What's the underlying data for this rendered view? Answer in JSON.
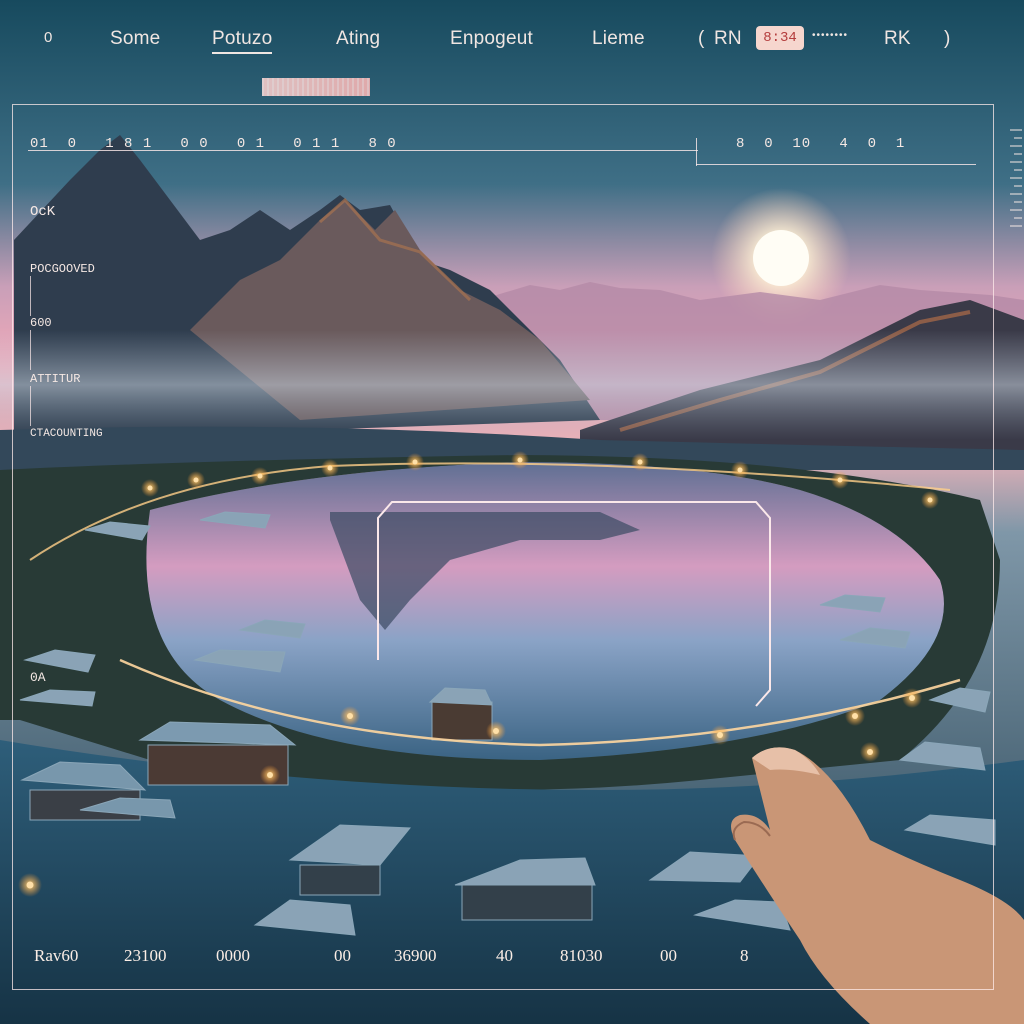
{
  "nav": {
    "indicator": "0",
    "items": [
      "Some",
      "Potuzo",
      "Ating",
      "Enpogeut",
      "Lieme"
    ],
    "bracket_open": "(",
    "left_code": "RN",
    "badge": "8:34",
    "dots": "••••••••",
    "right_code": "RK",
    "bracket_close": ")"
  },
  "ruler": {
    "left": "01  0   1 8 1   0 0   0 1   0 1 1   8 0",
    "right": "8  0  10   4  0  1"
  },
  "sidebar_labels": [
    "OcK",
    "POCGOOVED",
    "600",
    "ATTITUR",
    "CTACOUNTING"
  ],
  "mid_label": "0A",
  "bottom_readouts": [
    "Rav60",
    "23100",
    "0000",
    "00",
    "36900",
    "40",
    "81030",
    "00",
    "8"
  ],
  "colors": {
    "sky_top": "#1c4d63",
    "sky_pink": "#f2a7b8",
    "sun": "#fff8e8",
    "lamp": "#ffb454",
    "ui_text": "#f0e6e2"
  }
}
